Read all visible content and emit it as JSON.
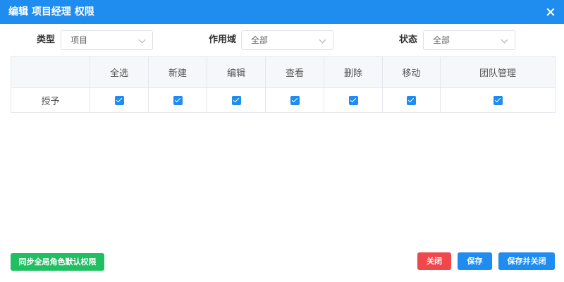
{
  "dialog": {
    "title": "编辑 项目经理 权限",
    "close_icon": "close-icon"
  },
  "filters": {
    "type": {
      "label": "类型",
      "value": "项目"
    },
    "scope": {
      "label": "作用域",
      "value": "全部"
    },
    "status": {
      "label": "状态",
      "value": "全部"
    }
  },
  "table": {
    "columns": [
      "",
      "全选",
      "新建",
      "编辑",
      "查看",
      "删除",
      "移动",
      "团队管理"
    ],
    "rows": [
      {
        "label": "授予",
        "checked": [
          true,
          true,
          true,
          true,
          true,
          true,
          true
        ]
      }
    ]
  },
  "buttons": {
    "sync": "同步全局角色默认权限",
    "close": "关闭",
    "save": "保存",
    "save_close": "保存并关闭"
  },
  "colors": {
    "primary": "#1f8cf0",
    "success": "#1fbf62",
    "danger": "#f0474c"
  }
}
